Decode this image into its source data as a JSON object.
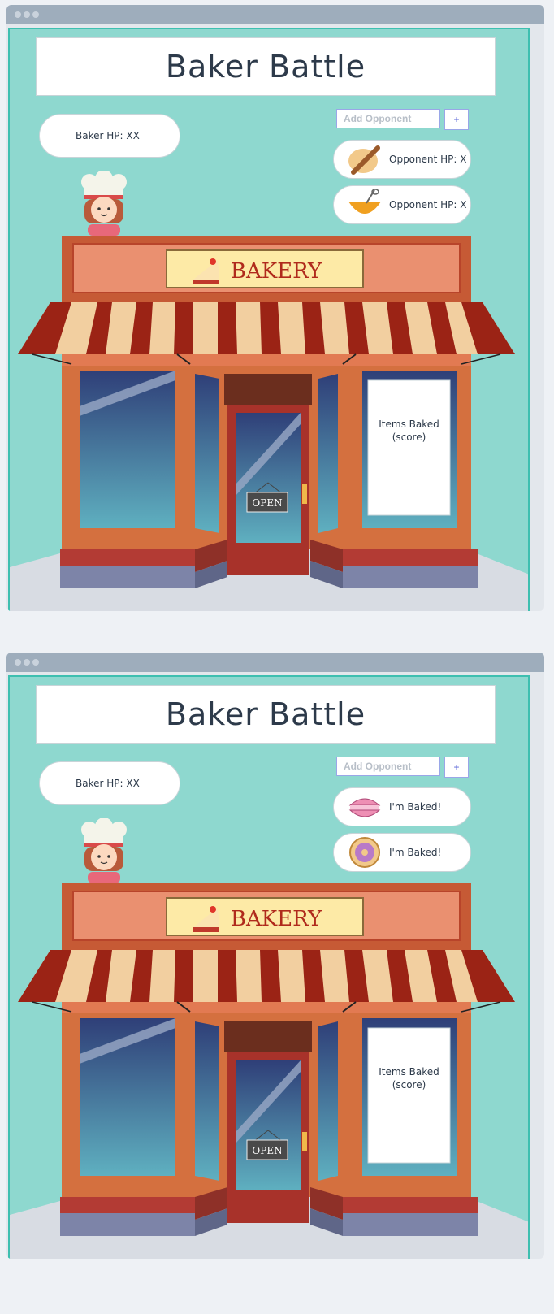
{
  "screens": [
    {
      "title": "Baker Battle",
      "baker_hp": "Baker HP: XX",
      "add_placeholder": "Add Opponent",
      "add_button": "+",
      "opponents": [
        {
          "label": "Opponent HP: X",
          "icon": "rolling-pin-icon"
        },
        {
          "label": "Opponent HP: X",
          "icon": "mixing-bowl-icon"
        }
      ],
      "sign": "BAKERY",
      "door_sign": "OPEN",
      "score_line1": "Items Baked",
      "score_line2": "(score)"
    },
    {
      "title": "Baker Battle",
      "baker_hp": "Baker HP: XX",
      "add_placeholder": "Add Opponent",
      "add_button": "+",
      "opponents": [
        {
          "label": "I'm Baked!",
          "icon": "macaron-icon"
        },
        {
          "label": "I'm Baked!",
          "icon": "pie-icon"
        }
      ],
      "sign": "BAKERY",
      "door_sign": "OPEN",
      "score_line1": "Items Baked",
      "score_line2": "(score)"
    }
  ],
  "colors": {
    "sky": "#8ed8cf",
    "brick": "#d4703f",
    "awning_red": "#9b2315",
    "awning_cream": "#f2cfa0",
    "door_red": "#a8322a",
    "sign_yellow": "#fdeaa6"
  }
}
